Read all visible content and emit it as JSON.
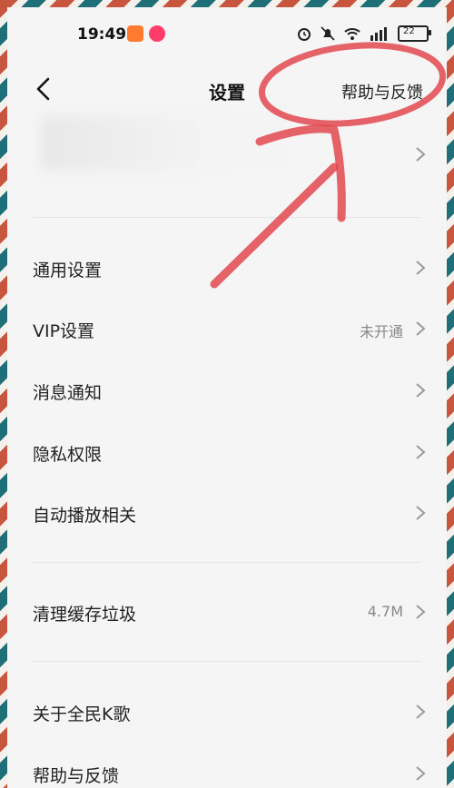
{
  "status_bar": {
    "time": "19:49",
    "battery_level": "22"
  },
  "nav": {
    "title": "设置",
    "help_label": "帮助与反馈"
  },
  "menu": {
    "general": {
      "label": "通用设置"
    },
    "vip": {
      "label": "VIP设置",
      "value": "未开通"
    },
    "notify": {
      "label": "消息通知"
    },
    "privacy": {
      "label": "隐私权限"
    },
    "autoplay": {
      "label": "自动播放相关"
    },
    "cache": {
      "label": "清理缓存垃圾",
      "value": "4.7M"
    },
    "about": {
      "label": "关于全民K歌"
    },
    "help": {
      "label": "帮助与反馈"
    }
  },
  "colors": {
    "background": "#f5f5f5",
    "text": "#222222",
    "secondary_text": "#888888",
    "annotation": "#e0484f"
  },
  "icons": [
    "back-arrow-icon",
    "chevron-right-icon",
    "alarm-icon",
    "mute-icon",
    "wifi-icon",
    "signal-icon",
    "battery-icon"
  ]
}
